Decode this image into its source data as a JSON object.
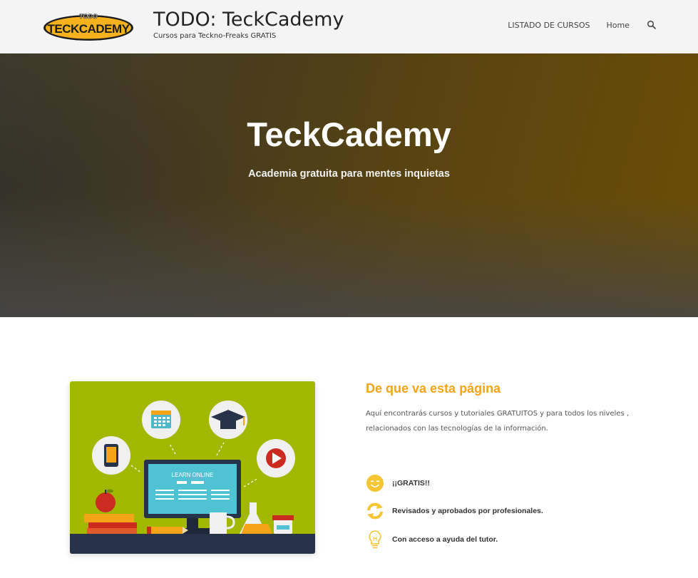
{
  "header": {
    "logo_text_small": "TODO",
    "logo_text": "TECKCADEMY",
    "site_title": "TODO: TeckCademy",
    "tagline": "Cursos para Teckno-Freaks GRATIS",
    "nav": [
      {
        "label": "LISTADO DE CURSOS"
      },
      {
        "label": "Home"
      }
    ],
    "search_icon": "search-icon"
  },
  "hero": {
    "title": "TeckCademy",
    "subtitle": "Academia gratuita para mentes inquietas"
  },
  "about": {
    "title": "De que va esta página",
    "text": "Aquí encontrarás cursos y tutoriales  GRATUITOS y para todos los niveles , relacionados con las tecnologías de la información.",
    "features": [
      {
        "icon": "smiley-icon",
        "label": "¡¡GRATIS!!"
      },
      {
        "icon": "refresh-icon",
        "label": "Revisados y aprobados por profesionales."
      },
      {
        "icon": "lightbulb-icon",
        "label": "Con acceso a ayuda del tutor."
      }
    ]
  },
  "illustration": {
    "screen_text": "LEARN ONLINE"
  },
  "colors": {
    "accent": "#f5a417",
    "illustration_bg": "#a3b800",
    "header_bg": "#f4f4f4"
  }
}
